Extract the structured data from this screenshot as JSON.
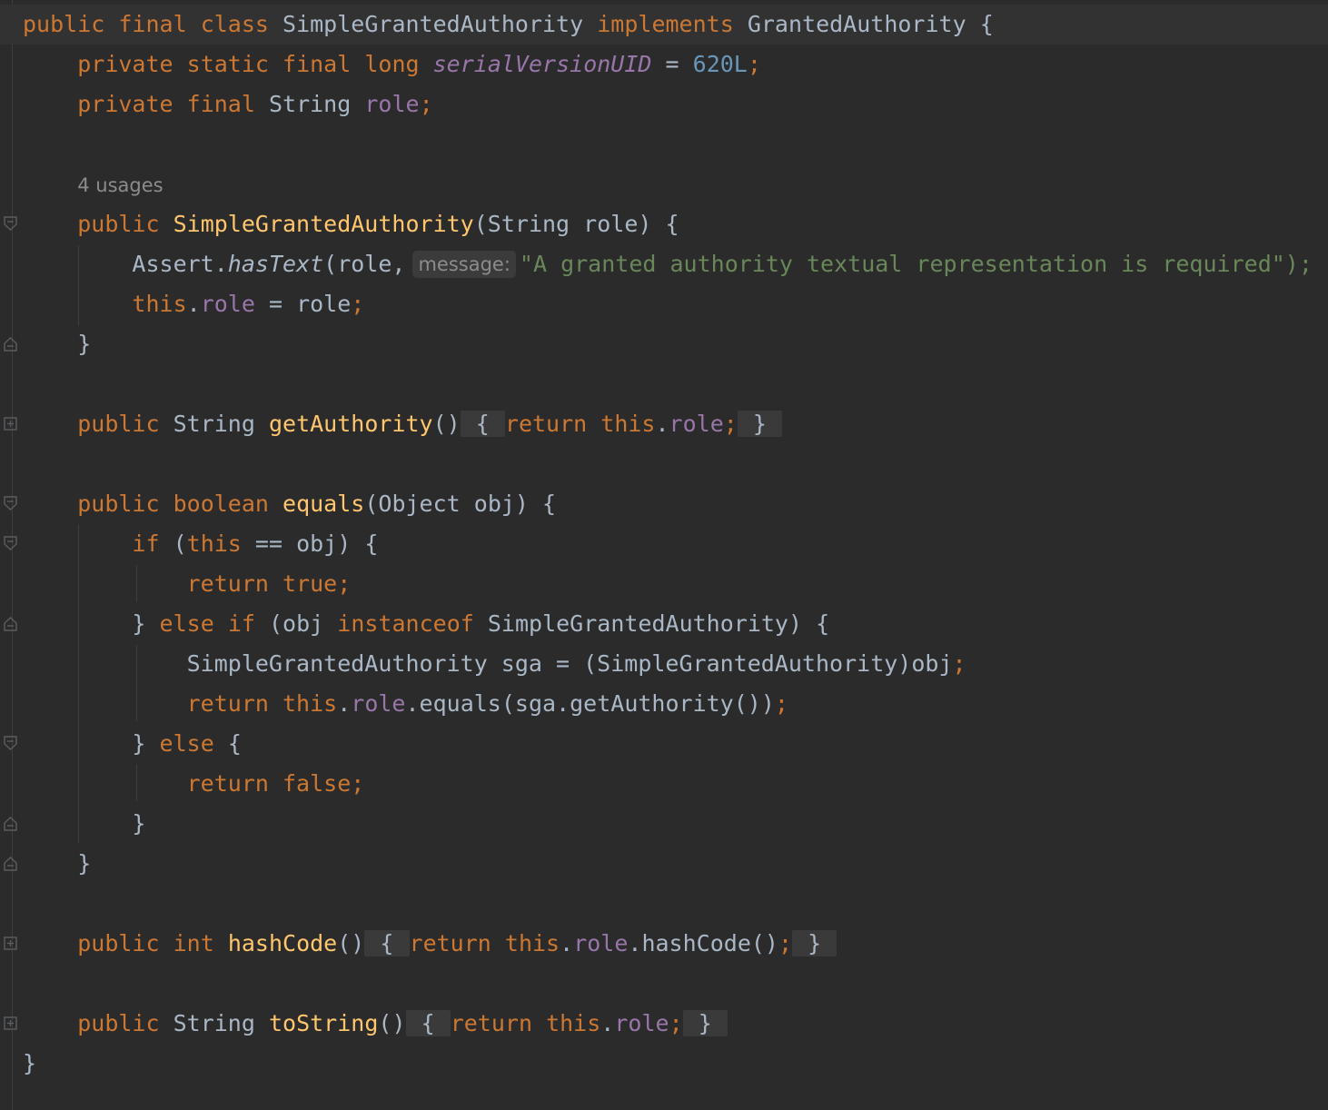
{
  "editor": {
    "lines": {
      "class_decl": {
        "kw1": "public",
        "kw2": "final",
        "kw3": "class",
        "name": "SimpleGrantedAuthority",
        "kw4": "implements",
        "iface": "GrantedAuthority",
        "brace": "{"
      },
      "field1": {
        "kw1": "private",
        "kw2": "static",
        "kw3": "final",
        "kw4": "long",
        "name": "serialVersionUID",
        "eq": "=",
        "value": "620L",
        "semi": ";"
      },
      "field2": {
        "kw1": "private",
        "kw2": "final",
        "type": "String",
        "name": "role",
        "semi": ";"
      },
      "usages": "4 usages",
      "ctor_decl": {
        "kw": "public",
        "name": "SimpleGrantedAuthority",
        "open": "(",
        "ptype": "String",
        "pname": "role",
        "close": ") {"
      },
      "assert_line": {
        "obj": "Assert",
        "dot": ".",
        "method": "hasText",
        "args": "(role,",
        "hint": "message:",
        "str": "\"A granted authority textual representation is required\");"
      },
      "assign_line": {
        "this": "this",
        "dot": ".",
        "field": "role",
        "rest": " = role",
        "semi": ";"
      },
      "close1": "}",
      "get_authority": {
        "kw": "public",
        "type": "String",
        "name": "getAuthority",
        "paren": "()",
        "ob": "{",
        "ret": "return",
        "this": "this",
        "dot": ".",
        "field": "role",
        "semi": ";",
        "cb": "}"
      },
      "equals_decl": {
        "kw1": "public",
        "kw2": "boolean",
        "name": "equals",
        "open": "(",
        "ptype": "Object",
        "pname": "obj",
        "close": ") {"
      },
      "if_line": {
        "kw": "if",
        "open": "(",
        "this": "this",
        "rest": " == obj) {"
      },
      "ret_true": {
        "kw": "return",
        "val": "true",
        "semi": ";"
      },
      "else_if": {
        "cb": "}",
        "kw1": "else",
        "kw2": "if",
        "open": "(obj",
        "kw3": "instanceof",
        "rest": "SimpleGrantedAuthority) {"
      },
      "sga_line": {
        "text": "SimpleGrantedAuthority sga = (SimpleGrantedAuthority)obj",
        "semi": ";"
      },
      "ret_equals": {
        "kw": "return",
        "this": "this",
        "dot": ".",
        "field": "role",
        "rest": ".equals(sga.getAuthority())",
        "semi": ";"
      },
      "else_line": {
        "cb": "}",
        "kw": "else",
        "ob": "{"
      },
      "ret_false": {
        "kw": "return",
        "val": "false",
        "semi": ";"
      },
      "close2": "}",
      "close3": "}",
      "hash_code": {
        "kw1": "public",
        "kw2": "int",
        "name": "hashCode",
        "paren": "()",
        "ob": "{",
        "ret": "return",
        "this": "this",
        "dot": ".",
        "field": "role",
        "rest": ".hashCode()",
        "semi": ";",
        "cb": "}"
      },
      "to_string": {
        "kw": "public",
        "type": "String",
        "name": "toString",
        "paren": "()",
        "ob": "{",
        "ret": "return",
        "this": "this",
        "dot": ".",
        "field": "role",
        "semi": ";",
        "cb": "}"
      },
      "class_close": "}"
    }
  }
}
